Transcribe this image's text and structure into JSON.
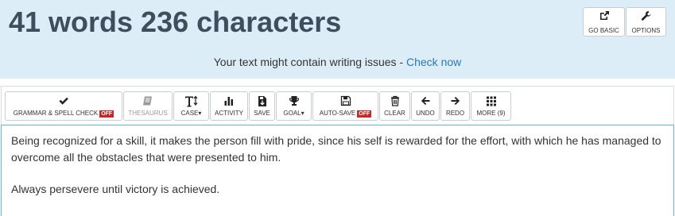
{
  "header": {
    "title": "41 words 236 characters",
    "go_basic_label": "GO BASIC",
    "options_label": "OPTIONS",
    "notice_text": "Your text might contain writing issues - ",
    "notice_link": "Check now"
  },
  "toolbar": {
    "grammar_label": "GRAMMAR & SPELL CHECK",
    "grammar_state": "OFF",
    "thesaurus_label": "THESAURUS",
    "case_label": "CASE",
    "activity_label": "ACTIVITY",
    "save_label": "SAVE",
    "goal_label": "GOAL",
    "autosave_label": "AUTO-SAVE",
    "autosave_state": "OFF",
    "clear_label": "CLEAR",
    "undo_label": "UNDO",
    "redo_label": "REDO",
    "more_label": "MORE (9)"
  },
  "editor": {
    "paragraph_1": "Being recognized for a skill, it makes the person fill with pride, since his self is rewarded for the effort, with which he has managed to overcome all the obstacles that were presented to him.",
    "paragraph_2": "Always persevere until victory is achieved."
  },
  "colors": {
    "header_bg": "#dcedf8",
    "title_text": "#3f4e5c",
    "link": "#2a7ab0",
    "off_badge": "#c62828",
    "editor_focus_border": "#66afe9"
  },
  "icons": {
    "go_basic": "external-link-icon",
    "options": "wrench-icon",
    "grammar": "checkmark-icon",
    "thesaurus": "book-icon",
    "case": "text-case-icon",
    "activity": "bar-chart-icon",
    "save": "save-download-icon",
    "goal": "trophy-icon",
    "autosave": "floppy-disk-icon",
    "clear": "trash-icon",
    "undo": "arrow-left-icon",
    "redo": "arrow-right-icon",
    "more": "grid-icon"
  }
}
